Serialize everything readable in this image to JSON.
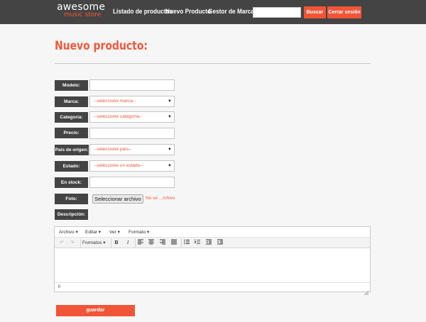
{
  "brand": {
    "line1": "awesome",
    "line2": "music store"
  },
  "nav": {
    "links": [
      "Listado de productos",
      "Nuevo Producto",
      "Gestor de Marcas"
    ],
    "search_placeholder": "",
    "search_button": "Buscar",
    "logout_button": "Cerrar sesión"
  },
  "page": {
    "title": "Nuevo producto:"
  },
  "form": {
    "modelo": {
      "label": "Modelo:",
      "value": ""
    },
    "marca": {
      "label": "Marca:",
      "selected": "--seleccione marca--"
    },
    "categoria": {
      "label": "Categoría:",
      "selected": "--seleccione categoría--"
    },
    "precio": {
      "label": "Precio:",
      "value": ""
    },
    "pais": {
      "label": "País de origen:",
      "selected": "--seleccione país--"
    },
    "estado": {
      "label": "Estado:",
      "selected": "--seleccione un estado--"
    },
    "stock": {
      "label": "En stock:",
      "value": ""
    },
    "foto": {
      "label": "Foto:",
      "button": "Seleccionar archivo",
      "status": "No se ...rchivo"
    },
    "descripcion": {
      "label": "Descripción:"
    },
    "save_button": "guardar"
  },
  "editor": {
    "menus": [
      "Archivo",
      "Editar",
      "Ver",
      "Formato"
    ],
    "formats_label": "Formatos",
    "path": "p"
  },
  "colors": {
    "accent": "#f05537",
    "navbar": "#444444",
    "label_bg": "#444444"
  }
}
